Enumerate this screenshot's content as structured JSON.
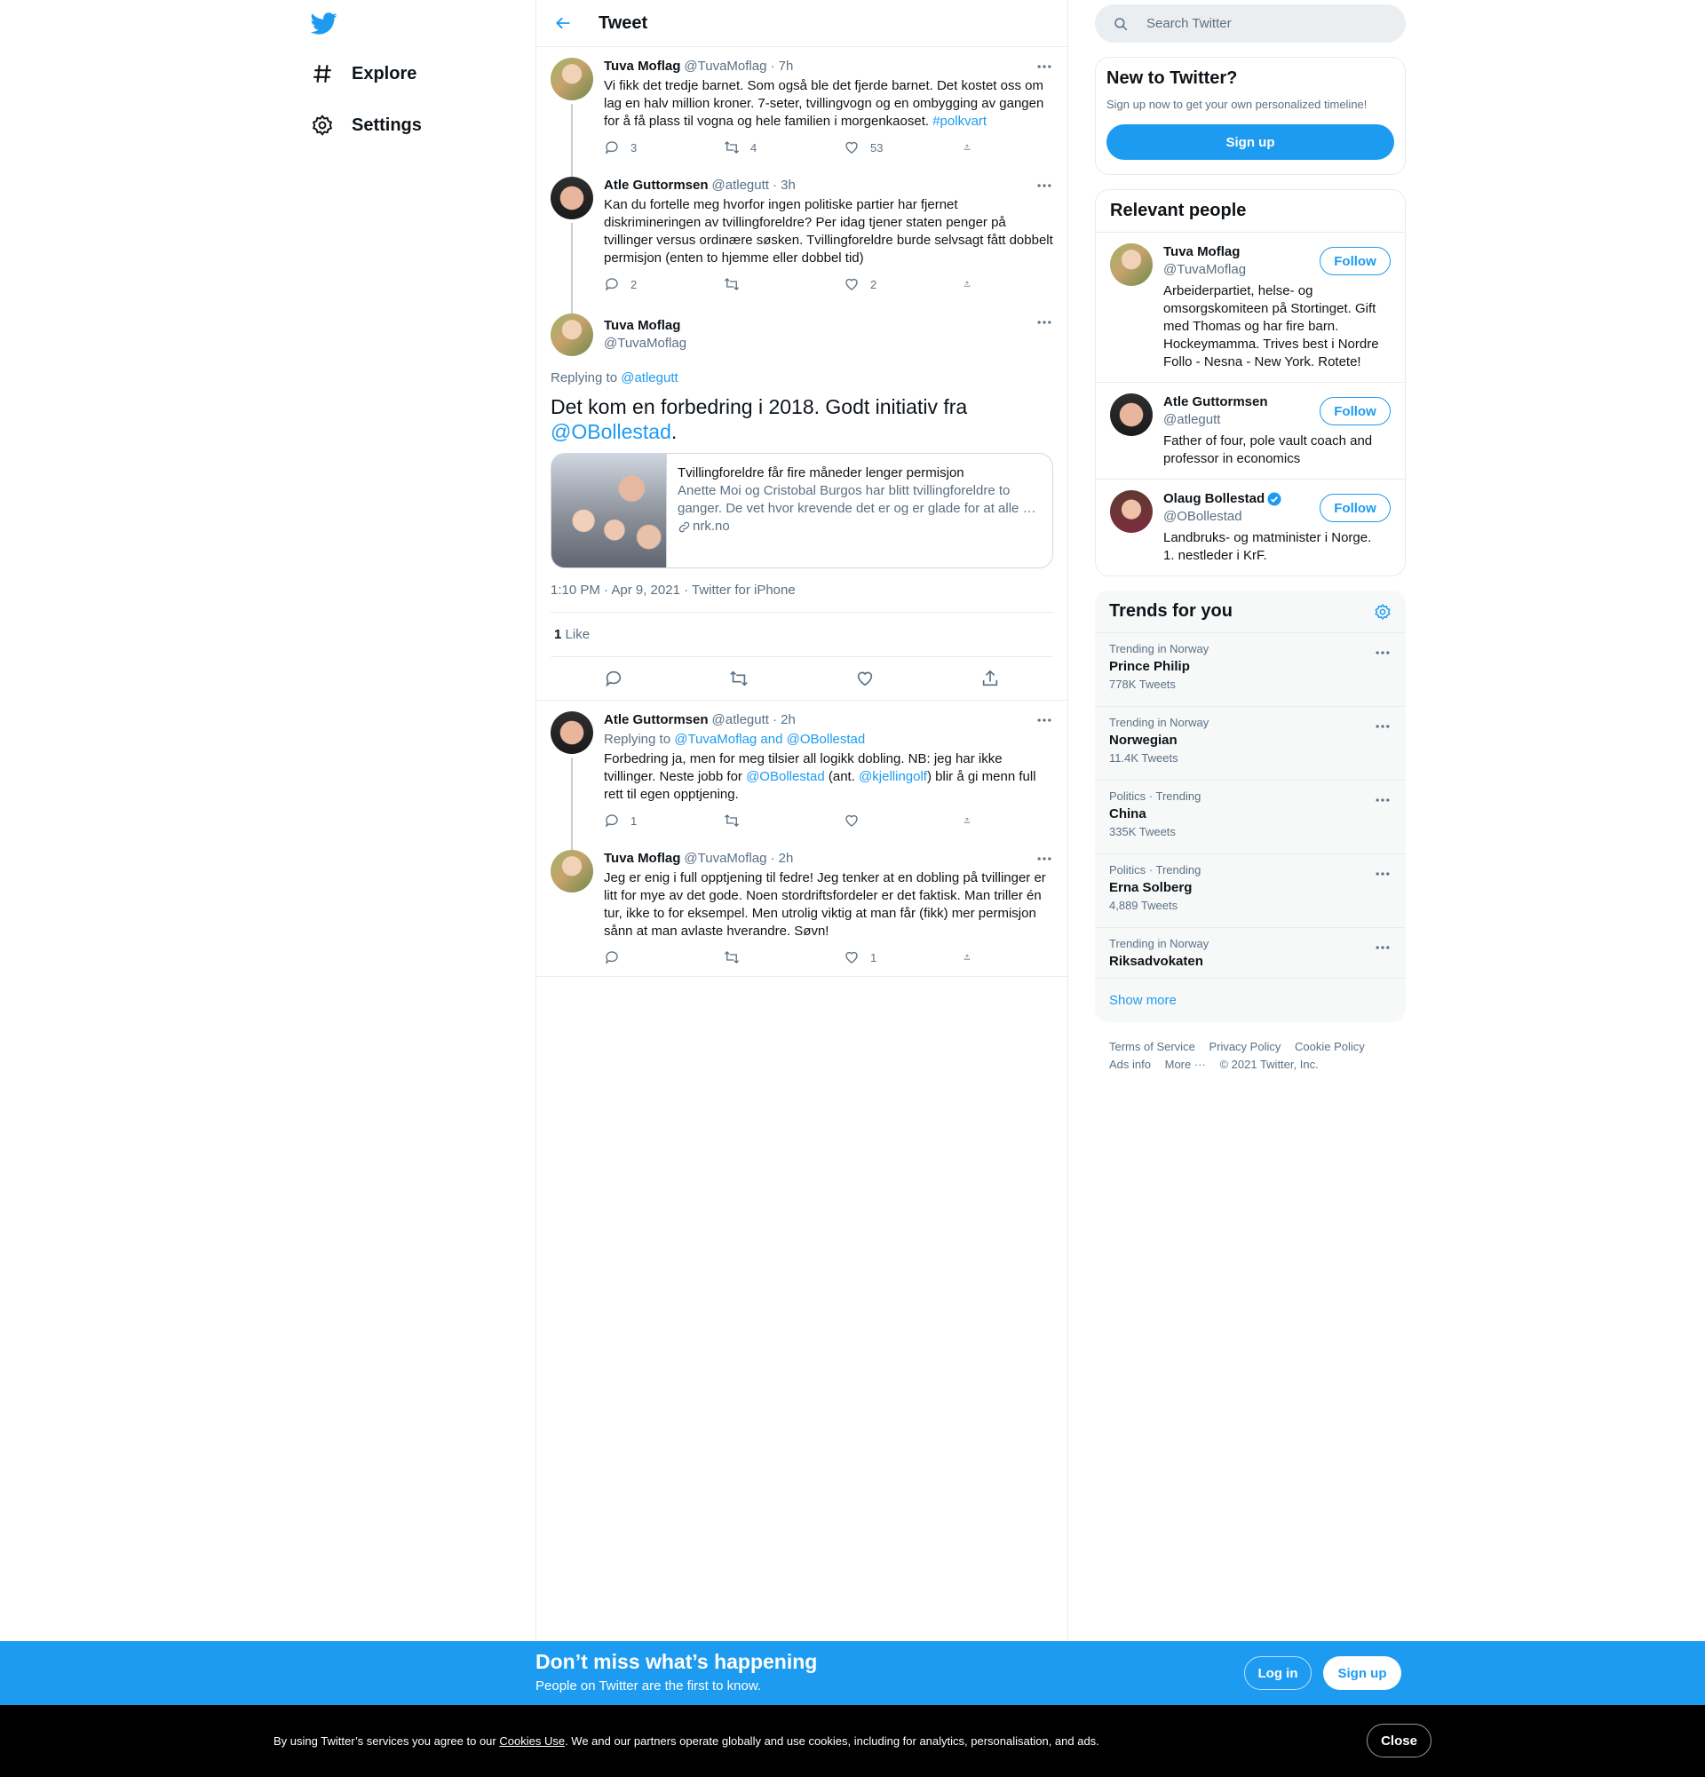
{
  "nav": {
    "explore": "Explore",
    "settings": "Settings"
  },
  "header": {
    "title": "Tweet"
  },
  "tweets_before": [
    {
      "name": "Tuva Moflag",
      "handle": "@TuvaMoflag",
      "time": "· 7h",
      "text_plain": "Vi fikk det tredje barnet. Som også ble det fjerde barnet. Det kostet oss om lag en halv million kroner. 7-seter, tvillingvogn og en ombygging av gangen for å få plass til vogna og hele familien i morgenkaoset. ",
      "hashtag": "#polkvart",
      "replies": "3",
      "retweets": "4",
      "likes": "53"
    },
    {
      "name": "Atle Guttormsen",
      "handle": "@atlegutt",
      "time": "· 3h",
      "text": "Kan du fortelle meg hvorfor ingen politiske partier har fjernet diskrimineringen av tvillingforeldre? Per idag tjener staten penger på tvillinger versus ordinære søsken. Tvillingforeldre burde selvsagt fått dobbelt permisjon (enten to hjemme eller dobbel tid)",
      "replies": "2",
      "retweets": "",
      "likes": "2"
    }
  ],
  "focal": {
    "name": "Tuva Moflag",
    "handle": "@TuvaMoflag",
    "replying_label": "Replying to",
    "replying_to": "@atlegutt",
    "text": "Det kom en forbedring i 2018. Godt initiativ fra",
    "mention": "@OBollestad",
    "text_end": ".",
    "card": {
      "title": "Tvillingforeldre får fire måneder lenger permisjon",
      "description": "Anette Moi og Cristobal Burgos har blitt tvillingforeldre to ganger. De vet hvor krevende det er og er glade for at alle …",
      "domain": "nrk.no"
    },
    "timestamp": "1:10 PM · Apr 9, 2021 · Twitter for iPhone",
    "like_count": "1",
    "like_label": "Like"
  },
  "tweets_after": [
    {
      "name": "Atle Guttormsen",
      "handle": "@atlegutt",
      "time": "· 2h",
      "replying_label": "Replying to",
      "replying_to": "@TuvaMoflag and @OBollestad",
      "text_1": "Forbedring ja, men for meg tilsier all logikk dobling. NB: jeg har ikke tvillinger. Neste jobb for ",
      "mention_1": "@OBollestad",
      "text_2": " (ant. ",
      "mention_2": "@kjellingolf",
      "text_3": ") blir å gi menn full rett til egen opptjening.",
      "replies": "1",
      "retweets": "",
      "likes": ""
    },
    {
      "name": "Tuva Moflag",
      "handle": "@TuvaMoflag",
      "time": "· 2h",
      "text": "Jeg er enig i full opptjening til fedre! Jeg tenker at en dobling på tvillinger er litt for mye av det gode. Noen stordriftsfordeler er det faktisk. Man triller én tur, ikke to for eksempel. Men utrolig viktig at man får (fikk) mer permisjon sånn at man avlaste hverandre. Søvn!",
      "replies": "",
      "retweets": "",
      "likes": "1"
    }
  ],
  "search": {
    "placeholder": "Search Twitter"
  },
  "new_to_twitter": {
    "title": "New to Twitter?",
    "subtitle": "Sign up now to get your own personalized timeline!",
    "button": "Sign up"
  },
  "relevant_people": {
    "title": "Relevant people",
    "follow_label": "Follow",
    "people": [
      {
        "name": "Tuva Moflag",
        "handle": "@TuvaMoflag",
        "bio": "Arbeiderpartiet, helse- og omsorgskomiteen på Stortinget. Gift med Thomas og har fire barn. Hockeymamma. Trives best i Nordre Follo - Nesna - New York. Rotete!"
      },
      {
        "name": "Atle Guttormsen",
        "handle": "@atlegutt",
        "bio": "Father of four, pole vault coach and professor in economics"
      },
      {
        "name": "Olaug Bollestad",
        "handle": "@OBollestad",
        "bio": "Landbruks- og matminister i Norge. 1. nestleder i KrF."
      }
    ]
  },
  "trends": {
    "title": "Trends for you",
    "items": [
      {
        "category": "Trending in Norway",
        "name": "Prince Philip",
        "count": "778K Tweets"
      },
      {
        "category": "Trending in Norway",
        "name": "Norwegian",
        "count": "11.4K Tweets"
      },
      {
        "category": "Politics · Trending",
        "name": "China",
        "count": "335K Tweets"
      },
      {
        "category": "Politics · Trending",
        "name": "Erna Solberg",
        "count": "4,889 Tweets"
      },
      {
        "category": "Trending in Norway",
        "name": "Riksadvokaten",
        "count": ""
      }
    ],
    "show_more": "Show more"
  },
  "footer": {
    "terms": "Terms of Service",
    "privacy": "Privacy Policy",
    "cookie": "Cookie Policy",
    "ads": "Ads info",
    "more": "More ···",
    "copyright": "© 2021 Twitter, Inc."
  },
  "bottom_bar": {
    "title": "Don’t miss what’s happening",
    "subtitle": "People on Twitter are the first to know.",
    "login": "Log in",
    "signup": "Sign up"
  },
  "cookie_bar": {
    "text_1": "By using Twitter’s services you agree to our ",
    "link": "Cookies Use",
    "text_2": ". We and our partners operate globally and use cookies, including for analytics, personalisation, and ads.",
    "close": "Close"
  },
  "colors": {
    "accent": "#1d9bf0",
    "text_secondary": "#5b7083",
    "border": "#e6ecf0"
  }
}
